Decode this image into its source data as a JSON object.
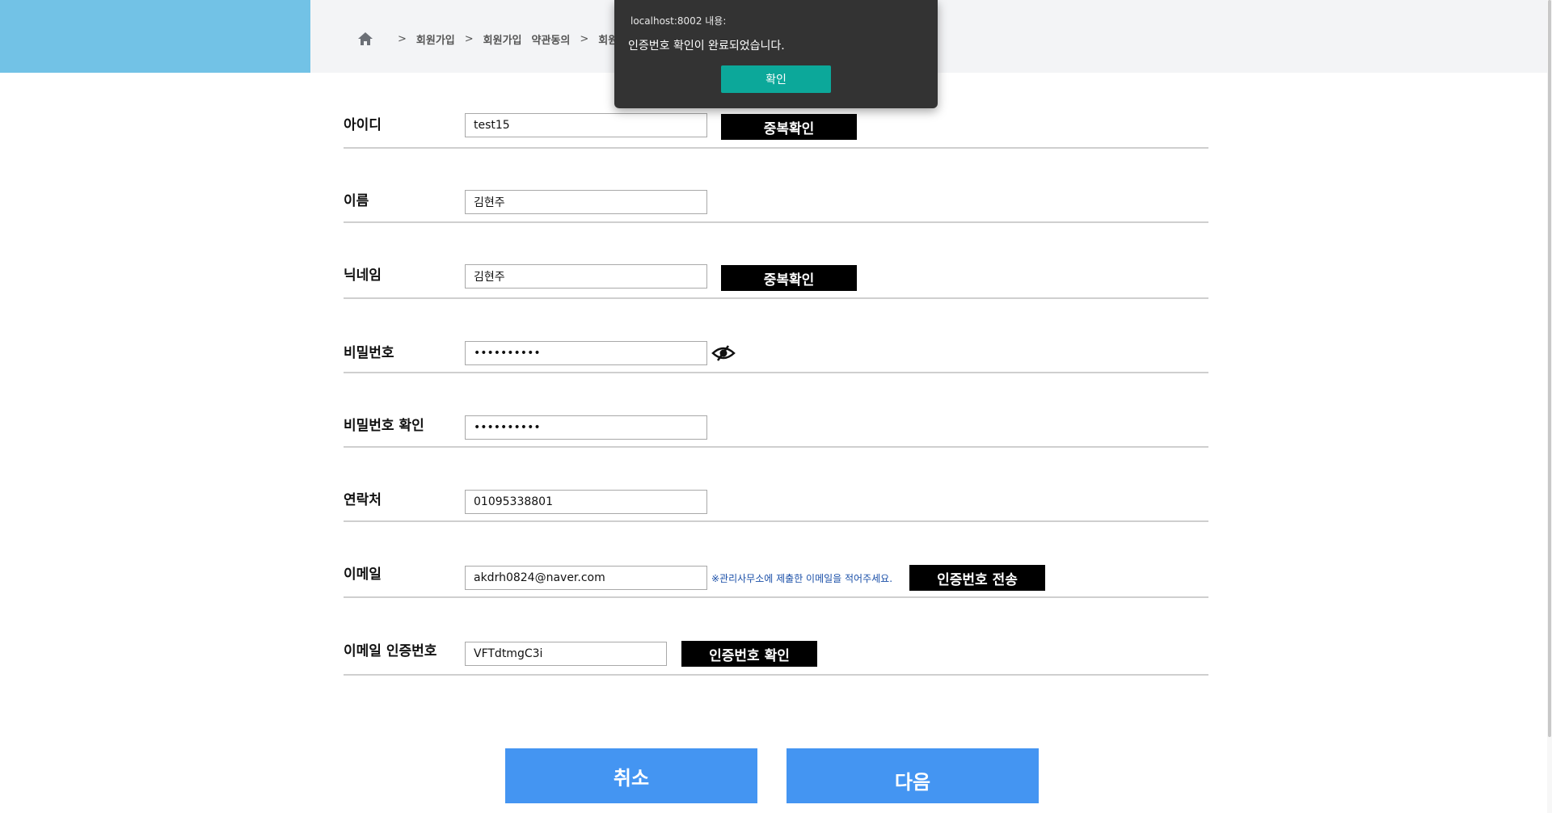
{
  "breadcrumb": {
    "home_icon": "home-icon",
    "separator": ">",
    "items": [
      "회원가입",
      "회원가입",
      "약관동의",
      "회원"
    ]
  },
  "form": {
    "id": {
      "label": "아이디",
      "value": "test15",
      "button": "중복확인"
    },
    "name": {
      "label": "이름",
      "value": "김현주"
    },
    "nickname": {
      "label": "닉네임",
      "value": "김현주",
      "button": "중복확인"
    },
    "password": {
      "label": "비밀번호",
      "value": "••••••••••",
      "toggle_icon": "eye-slash-icon"
    },
    "password_confirm": {
      "label": "비밀번호 확인",
      "value": "••••••••••"
    },
    "phone": {
      "label": "연락처",
      "value": "01095338801"
    },
    "email": {
      "label": "이메일",
      "value": "akdrh0824@naver.com",
      "note": "※관리사무소에 제출한 이메일을 적어주세요.",
      "button": "인증번호 전송"
    },
    "email_code": {
      "label": "이메일 인증번호",
      "value": "VFTdtmgC3i",
      "button": "인증번호 확인"
    }
  },
  "actions": {
    "cancel": "취소",
    "next": "다음"
  },
  "alert": {
    "title": "localhost:8002 내용:",
    "message": "인증번호 확인이 완료되었습니다.",
    "ok": "확인"
  },
  "colors": {
    "header_blue": "#72c2e6",
    "primary_button": "#4495f2",
    "alert_ok": "#0ca89a",
    "note_text": "#1a4fa8"
  }
}
